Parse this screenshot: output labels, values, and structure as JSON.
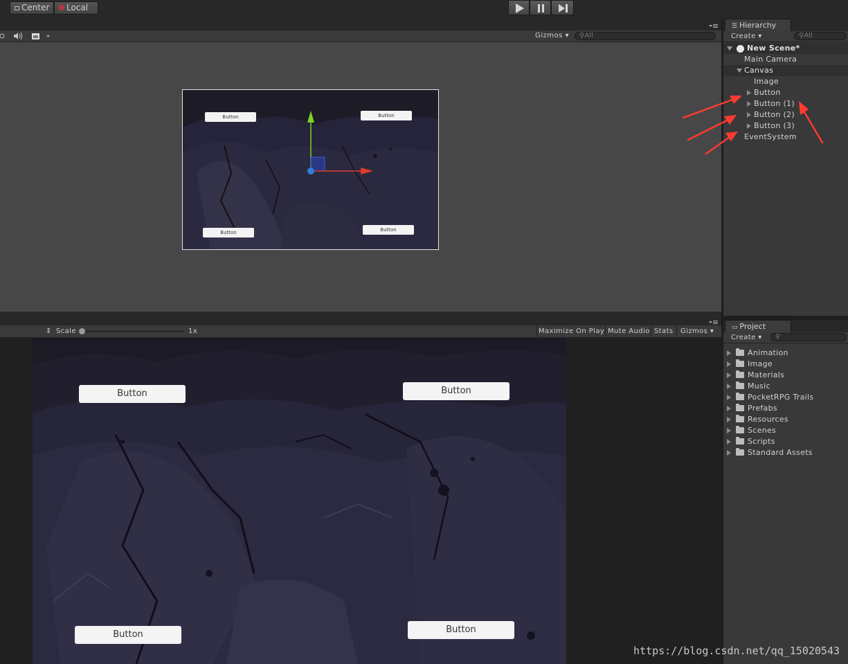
{
  "toolbar": {
    "pivot_label": "Center",
    "space_label": "Local"
  },
  "scene": {
    "gizmos_label": "Gizmos",
    "search_placeholder": "All",
    "buttons": [
      "Button",
      "Button",
      "Button",
      "Button"
    ]
  },
  "game": {
    "scale_label": "Scale",
    "scale_value": "1x",
    "maximize_label": "Maximize On Play",
    "mute_label": "Mute Audio",
    "stats_label": "Stats",
    "gizmos_label": "Gizmos",
    "buttons": [
      "Button",
      "Button",
      "Button",
      "Button"
    ]
  },
  "hierarchy": {
    "tab_label": "Hierarchy",
    "create_label": "Create",
    "search_placeholder": "All",
    "scene_name": "New Scene*",
    "items": [
      {
        "label": "Main Camera"
      },
      {
        "label": "Canvas"
      },
      {
        "label": "Image"
      },
      {
        "label": "Button"
      },
      {
        "label": "Button (1)"
      },
      {
        "label": "Button (2)"
      },
      {
        "label": "Button (3)"
      },
      {
        "label": "EventSystem"
      }
    ]
  },
  "project": {
    "tab_label": "Project",
    "create_label": "Create",
    "folders": [
      "Animation",
      "Image",
      "Materials",
      "Music",
      "PocketRPG Trails",
      "Prefabs",
      "Resources",
      "Scenes",
      "Scripts",
      "Standard Assets"
    ]
  },
  "watermark": "https://blog.csdn.net/qq_15020543",
  "colors": {
    "annotation_arrow": "#ff3b30",
    "gizmo_x": "#e03c2b",
    "gizmo_y": "#7ed321",
    "gizmo_center": "#2f7fe0",
    "background_art": "#22212e"
  }
}
